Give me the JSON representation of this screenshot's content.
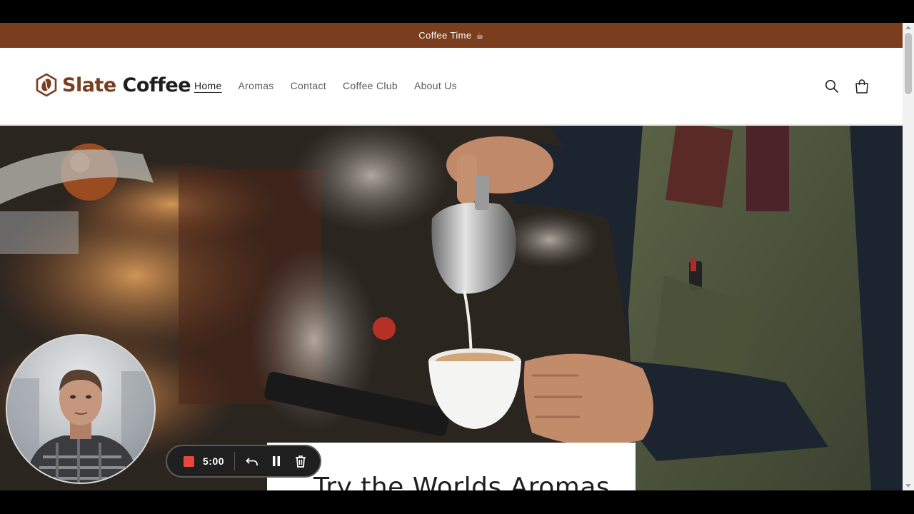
{
  "announcement": {
    "text": "Coffee Time",
    "icon": "coffee-cup-icon"
  },
  "brand": {
    "word1": "Slate",
    "word2": "Coffee",
    "accent_color": "#7a3e1f"
  },
  "nav": {
    "items": [
      {
        "label": "Home",
        "active": true
      },
      {
        "label": "Aromas",
        "active": false
      },
      {
        "label": "Contact",
        "active": false
      },
      {
        "label": "Coffee Club",
        "active": false
      },
      {
        "label": "About Us",
        "active": false
      }
    ]
  },
  "header_icons": [
    "search-icon",
    "cart-icon"
  ],
  "hero": {
    "title": "Try the Worlds Aromas"
  },
  "recorder": {
    "time": "5:00",
    "controls": [
      "stop-icon",
      "undo-icon",
      "pause-icon",
      "trash-icon"
    ],
    "stop_color": "#e8473d"
  }
}
